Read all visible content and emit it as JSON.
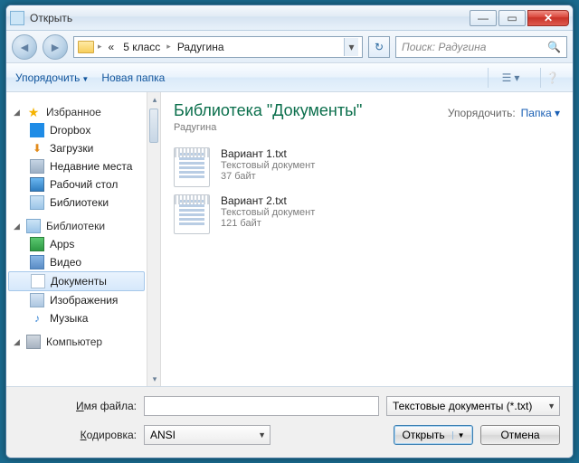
{
  "window": {
    "title": "Открыть"
  },
  "nav": {
    "crumb_ellipsis": "«",
    "crumb1": "5 класс",
    "crumb2": "Радугина"
  },
  "search": {
    "placeholder": "Поиск: Радугина"
  },
  "toolbar": {
    "organize": "Упорядочить",
    "newfolder": "Новая папка"
  },
  "sidebar": {
    "fav": "Избранное",
    "fav_items": [
      "Dropbox",
      "Загрузки",
      "Недавние места",
      "Рабочий стол",
      "Библиотеки"
    ],
    "lib": "Библиотеки",
    "lib_items": [
      "Apps",
      "Видео",
      "Документы",
      "Изображения",
      "Музыка"
    ],
    "comp": "Компьютер"
  },
  "content": {
    "lib_title": "Библиотека \"Документы\"",
    "lib_sub": "Радугина",
    "arrange_label": "Упорядочить:",
    "arrange_value": "Папка",
    "files": [
      {
        "name": "Вариант 1.txt",
        "type": "Текстовый документ",
        "size": "37 байт"
      },
      {
        "name": "Вариант 2.txt",
        "type": "Текстовый документ",
        "size": "121 байт"
      }
    ]
  },
  "bottom": {
    "filename_label": "Имя файла:",
    "filename_value": "",
    "filter": "Текстовые документы (*.txt)",
    "encoding_label": "Кодировка:",
    "encoding_value": "ANSI",
    "open": "Открыть",
    "cancel": "Отмена"
  }
}
